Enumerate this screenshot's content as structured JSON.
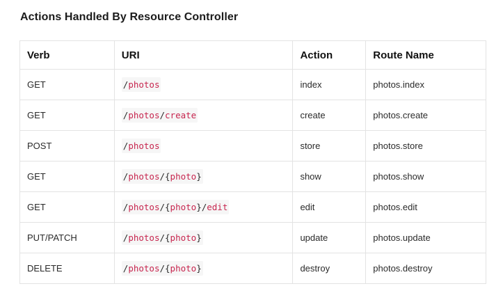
{
  "title": "Actions Handled By Resource Controller",
  "columns": [
    "Verb",
    "URI",
    "Action",
    "Route Name"
  ],
  "rows": [
    {
      "verb": "GET",
      "uri": [
        {
          "t": "sep",
          "v": "/"
        },
        {
          "t": "seg",
          "v": "photos"
        }
      ],
      "action": "index",
      "route": "photos.index"
    },
    {
      "verb": "GET",
      "uri": [
        {
          "t": "sep",
          "v": "/"
        },
        {
          "t": "seg",
          "v": "photos"
        },
        {
          "t": "sep",
          "v": "/"
        },
        {
          "t": "seg",
          "v": "create"
        }
      ],
      "action": "create",
      "route": "photos.create"
    },
    {
      "verb": "POST",
      "uri": [
        {
          "t": "sep",
          "v": "/"
        },
        {
          "t": "seg",
          "v": "photos"
        }
      ],
      "action": "store",
      "route": "photos.store"
    },
    {
      "verb": "GET",
      "uri": [
        {
          "t": "sep",
          "v": "/"
        },
        {
          "t": "seg",
          "v": "photos"
        },
        {
          "t": "sep",
          "v": "/{"
        },
        {
          "t": "seg",
          "v": "photo"
        },
        {
          "t": "sep",
          "v": "}"
        }
      ],
      "action": "show",
      "route": "photos.show"
    },
    {
      "verb": "GET",
      "uri": [
        {
          "t": "sep",
          "v": "/"
        },
        {
          "t": "seg",
          "v": "photos"
        },
        {
          "t": "sep",
          "v": "/{"
        },
        {
          "t": "seg",
          "v": "photo"
        },
        {
          "t": "sep",
          "v": "}/"
        },
        {
          "t": "seg",
          "v": "edit"
        }
      ],
      "action": "edit",
      "route": "photos.edit"
    },
    {
      "verb": "PUT/PATCH",
      "uri": [
        {
          "t": "sep",
          "v": "/"
        },
        {
          "t": "seg",
          "v": "photos"
        },
        {
          "t": "sep",
          "v": "/{"
        },
        {
          "t": "seg",
          "v": "photo"
        },
        {
          "t": "sep",
          "v": "}"
        }
      ],
      "action": "update",
      "route": "photos.update"
    },
    {
      "verb": "DELETE",
      "uri": [
        {
          "t": "sep",
          "v": "/"
        },
        {
          "t": "seg",
          "v": "photos"
        },
        {
          "t": "sep",
          "v": "/{"
        },
        {
          "t": "seg",
          "v": "photo"
        },
        {
          "t": "sep",
          "v": "}"
        }
      ],
      "action": "destroy",
      "route": "photos.destroy"
    }
  ],
  "colors": {
    "uri_segment": "#c7254e",
    "border": "#e3e3e3",
    "code_bg": "#f6f6f6"
  }
}
